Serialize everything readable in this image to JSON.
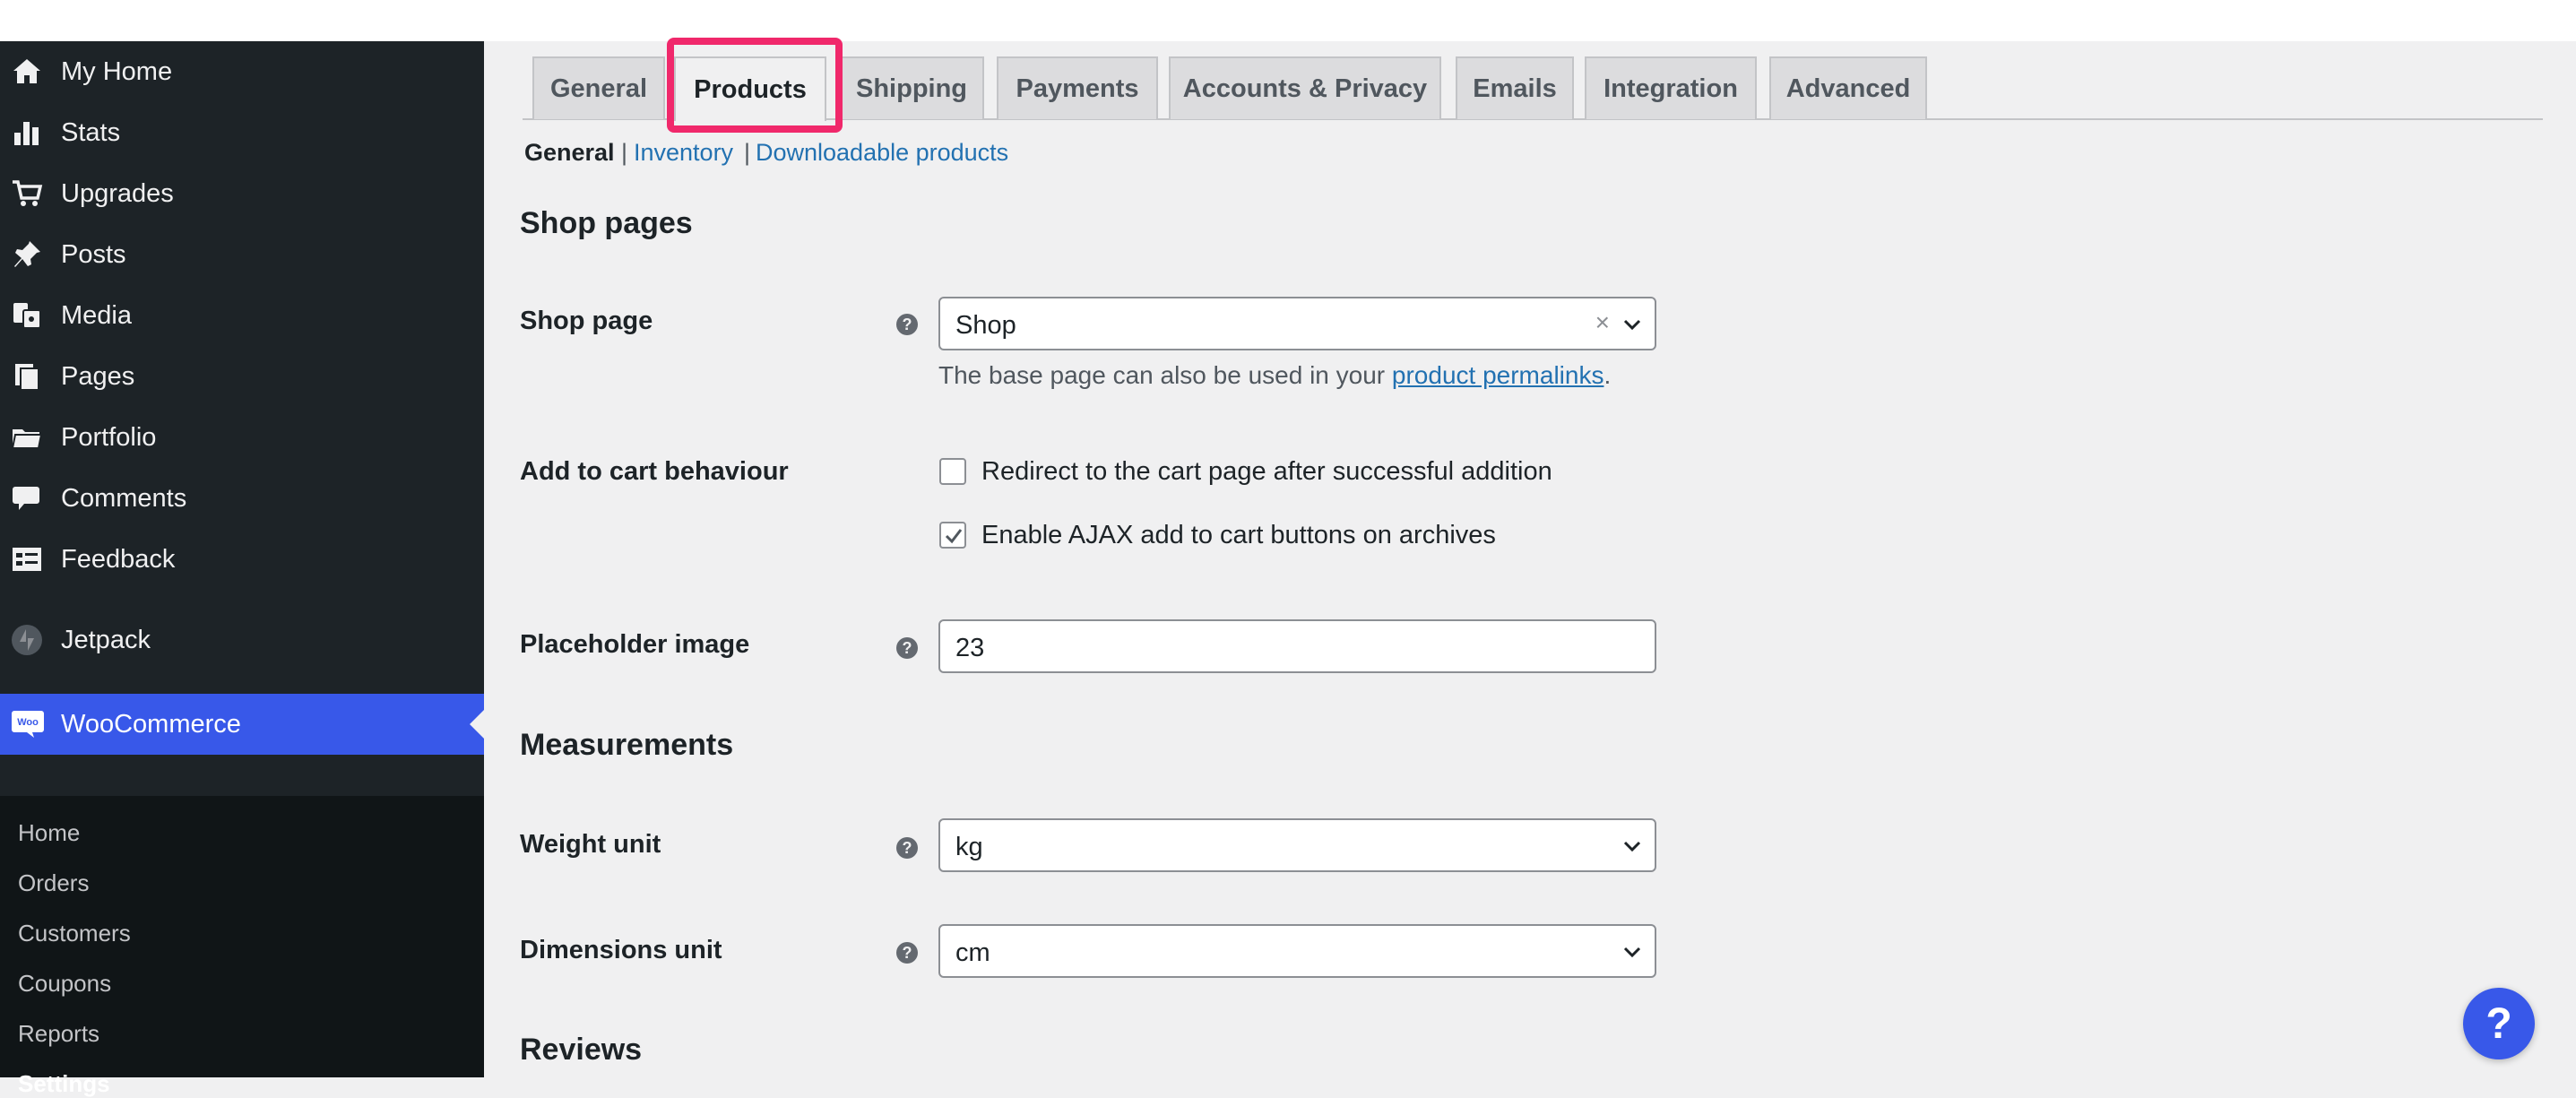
{
  "sidebar": {
    "items": [
      {
        "label": "My Home",
        "icon": "home-icon"
      },
      {
        "label": "Stats",
        "icon": "stats-icon"
      },
      {
        "label": "Upgrades",
        "icon": "cart-icon"
      },
      {
        "label": "Posts",
        "icon": "pin-icon"
      },
      {
        "label": "Media",
        "icon": "media-icon"
      },
      {
        "label": "Pages",
        "icon": "pages-icon"
      },
      {
        "label": "Portfolio",
        "icon": "folder-icon"
      },
      {
        "label": "Comments",
        "icon": "comment-icon"
      },
      {
        "label": "Feedback",
        "icon": "feedback-icon"
      },
      {
        "label": "Jetpack",
        "icon": "jetpack-icon"
      },
      {
        "label": "WooCommerce",
        "icon": "woo-icon"
      }
    ],
    "woo_badge": "Woo",
    "submenu": [
      "Home",
      "Orders",
      "Customers",
      "Coupons",
      "Reports",
      "Settings"
    ]
  },
  "tabs": [
    "General",
    "Products",
    "Shipping",
    "Payments",
    "Accounts & Privacy",
    "Emails",
    "Integration",
    "Advanced"
  ],
  "subnav": {
    "items": [
      "General",
      "Inventory",
      "Downloadable products"
    ],
    "separator": "|"
  },
  "shop_pages": {
    "title": "Shop pages",
    "shop_page_label": "Shop page",
    "shop_page_value": "Shop",
    "clear_symbol": "×",
    "desc_before": "The base page can also be used in your ",
    "desc_link": "product permalinks",
    "desc_after": ".",
    "add_to_cart_label": "Add to cart behaviour",
    "redirect_label": "Redirect to the cart page after successful addition",
    "redirect_checked": false,
    "ajax_label": "Enable AJAX add to cart buttons on archives",
    "ajax_checked": true,
    "placeholder_label": "Placeholder image",
    "placeholder_value": "23"
  },
  "measurements": {
    "title": "Measurements",
    "weight_label": "Weight unit",
    "weight_value": "kg",
    "dimensions_label": "Dimensions unit",
    "dimensions_value": "cm"
  },
  "reviews": {
    "title": "Reviews"
  },
  "help_symbol": "?",
  "help_fab": "?",
  "colors": {
    "accent": "#3858e9",
    "highlight": "#f0286b",
    "link": "#2271b1"
  }
}
